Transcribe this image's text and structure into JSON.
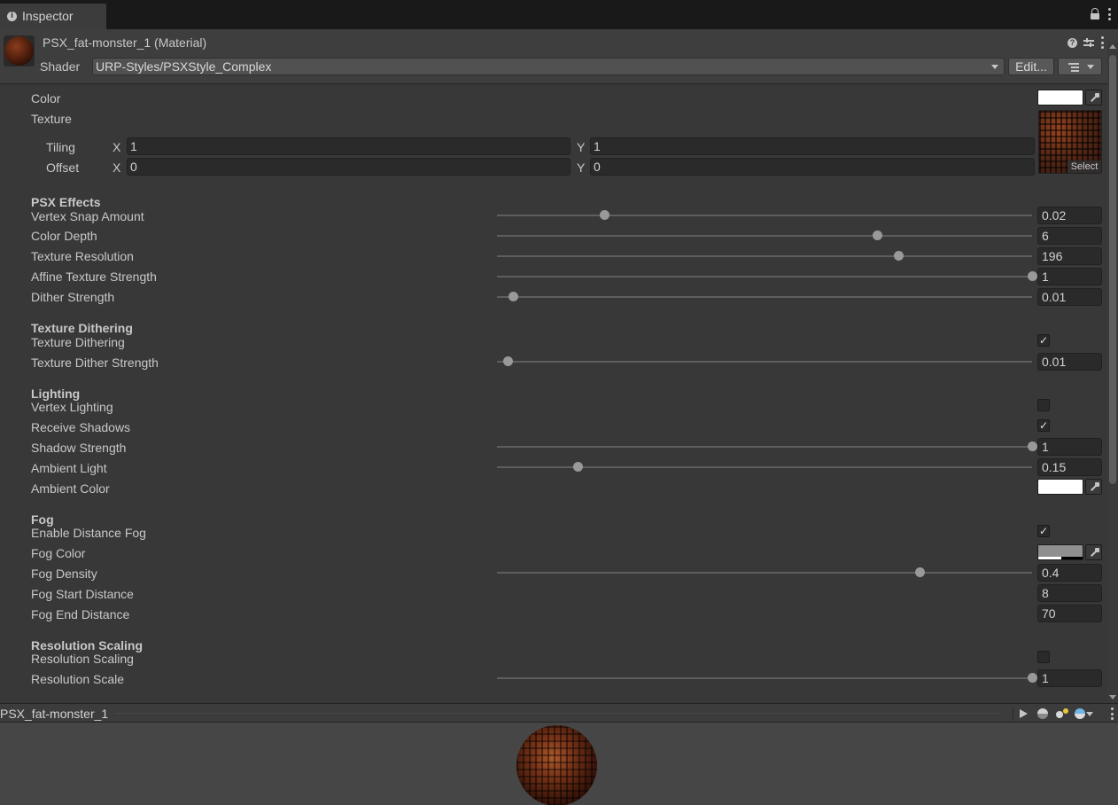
{
  "tab": {
    "label": "Inspector"
  },
  "header": {
    "title": "PSX_fat-monster_1 (Material)",
    "shader_label": "Shader",
    "shader_value": "URP-Styles/PSXStyle_Complex",
    "edit_label": "Edit..."
  },
  "main": {
    "color_label": "Color",
    "texture_label": "Texture",
    "texture_select": "Select",
    "tiling_label": "Tiling",
    "offset_label": "Offset",
    "x_label": "X",
    "y_label": "Y",
    "tiling": {
      "x": "1",
      "y": "1"
    },
    "offset": {
      "x": "0",
      "y": "0"
    }
  },
  "sections": {
    "psx": {
      "title": "PSX Effects",
      "vertex_snap": {
        "label": "Vertex Snap Amount",
        "value": "0.02",
        "fraction": 0.2
      },
      "color_depth": {
        "label": "Color Depth",
        "value": "6",
        "fraction": 0.71
      },
      "texture_resolution": {
        "label": "Texture Resolution",
        "value": "196",
        "fraction": 0.75
      },
      "affine": {
        "label": "Affine Texture Strength",
        "value": "1",
        "fraction": 1.0
      },
      "dither": {
        "label": "Dither Strength",
        "value": "0.01",
        "fraction": 0.03
      }
    },
    "texdither": {
      "title": "Texture Dithering",
      "enable": {
        "label": "Texture Dithering",
        "checked": true
      },
      "strength": {
        "label": "Texture Dither Strength",
        "value": "0.01",
        "fraction": 0.02
      }
    },
    "lighting": {
      "title": "Lighting",
      "vertex": {
        "label": "Vertex Lighting",
        "checked": false
      },
      "receive": {
        "label": "Receive Shadows",
        "checked": true
      },
      "shadow": {
        "label": "Shadow Strength",
        "value": "1",
        "fraction": 1.0
      },
      "ambient": {
        "label": "Ambient Light",
        "value": "0.15",
        "fraction": 0.15
      },
      "ambient_color": {
        "label": "Ambient Color"
      }
    },
    "fog": {
      "title": "Fog",
      "enable": {
        "label": "Enable Distance Fog",
        "checked": true
      },
      "color": {
        "label": "Fog Color"
      },
      "density": {
        "label": "Fog Density",
        "value": "0.4",
        "fraction": 0.79
      },
      "start": {
        "label": "Fog Start Distance",
        "value": "8"
      },
      "end": {
        "label": "Fog End Distance",
        "value": "70"
      }
    },
    "resscale": {
      "title": "Resolution Scaling",
      "enable": {
        "label": "Resolution Scaling",
        "checked": false
      },
      "scale": {
        "label": "Resolution Scale",
        "value": "1",
        "fraction": 1.0
      }
    }
  },
  "preview": {
    "name": "PSX_fat-monster_1"
  },
  "colors": {
    "background": "#383838",
    "field": "#2a2a2a",
    "knob": "#999999",
    "white_swatch": "#ffffff",
    "fog_swatch": "#8f8f8f"
  },
  "icons": [
    "info-icon",
    "lock-icon",
    "kebab-icon",
    "help-icon",
    "preset-sliders-icon",
    "eyedropper-icon",
    "list-icon",
    "play-icon",
    "sphere-icon",
    "lights-icon",
    "skybox-icon"
  ]
}
